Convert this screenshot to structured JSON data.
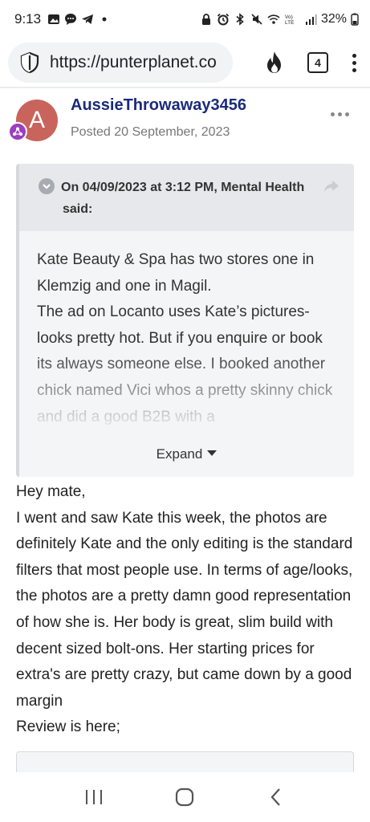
{
  "status_bar": {
    "time": "9:13",
    "battery": "32%",
    "icons_left": [
      "gallery-icon",
      "chat-icon",
      "telegram-icon",
      "dot-icon"
    ],
    "icons_right": [
      "lock-icon",
      "alarm-icon",
      "bluetooth-icon",
      "mute-icon",
      "wifi-icon",
      "volte-icon",
      "signal-icon",
      "battery-icon"
    ]
  },
  "browser": {
    "url": "https://punterplanet.co",
    "tab_count": "4"
  },
  "post": {
    "author": "AussieThrowaway3456",
    "avatar_letter": "A",
    "posted": "Posted 20 September, 2023",
    "quote": {
      "header": "On 04/09/2023 at 3:12 PM, Mental Health said:",
      "lines": [
        "Kate Beauty & Spa has two stores one in Klemzig and one in Magil.",
        "The ad on Locanto uses Kate’s pictures- looks pretty hot. But if you enquire or book its always someone else. I booked another chick named Vici whos a pretty skinny chick and did a good B2B with a"
      ],
      "expand_label": "Expand"
    },
    "body": [
      "Hey mate,",
      "I went and saw Kate this week, the photos are definitely Kate and the only editing is the standard filters that most people use. In terms of age/looks, the photos are a pretty damn good representation of how she is. Her body is great, slim build with decent sized bolt-ons. Her starting prices for extra's are pretty crazy, but came down by a good margin",
      "Review is here;"
    ]
  },
  "colors": {
    "author": "#1a2a7a",
    "avatar": "#c8645c",
    "badge": "#9b3fbf",
    "quote_bg": "#f4f5f6",
    "quote_head_bg": "#e6e8eb"
  }
}
